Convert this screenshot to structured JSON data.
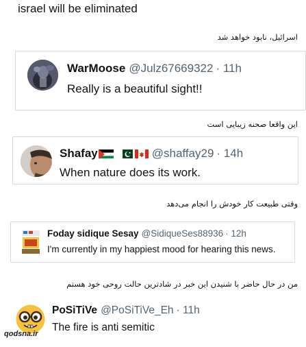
{
  "top_text": "israel will be eliminated",
  "captions": [
    "اسرائیل، نابود خواهد شد",
    "این واقعا صحنه زیبایی است",
    "وقتی طبیعت کار خودش را انجام می‌دهد",
    "من در حال حاضر با شنیدن این خبر در شادترین حالت روحی خود هستم"
  ],
  "tweets": [
    {
      "name": "WarMoose",
      "handle": "@Julz67669322",
      "time": "· 11h",
      "text": "Really is a beautiful sight!!"
    },
    {
      "name": "Shafay",
      "handle": "@shaffay29",
      "time": "· 14h",
      "text": "When nature does its work."
    },
    {
      "name": "Foday sidique Sesay",
      "handle": "@SidiqueSes88936",
      "time": "· 12h",
      "text": "I'm currently in my happiest mood for hearing this news."
    },
    {
      "name": "PoSiTiVe",
      "handle": "@PoSiTiVe_Eh",
      "time": "· 11h",
      "text": "The fire is anti semitic"
    }
  ],
  "watermark": "qodsna.ir",
  "colors": {
    "border": "#cfd9de",
    "handle": "#536471",
    "text": "#0f1419"
  }
}
